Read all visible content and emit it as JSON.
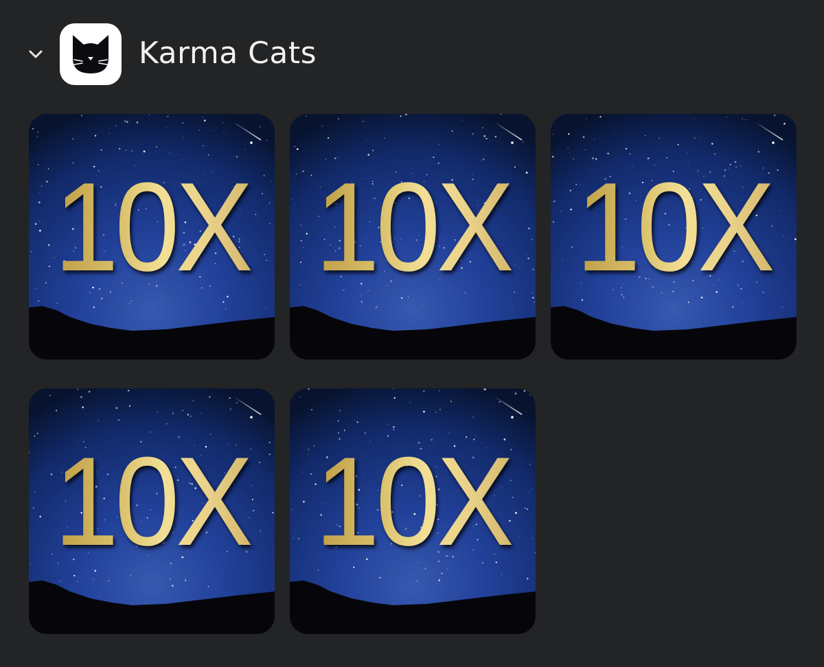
{
  "group": {
    "title": "Karma Cats",
    "icon": "black-cat-icon",
    "collapse_icon": "chevron-down-icon"
  },
  "tiles": [
    {
      "label": "10X"
    },
    {
      "label": "10X"
    },
    {
      "label": "10X"
    },
    {
      "label": "10X"
    },
    {
      "label": "10X"
    }
  ],
  "colors": {
    "background": "#222426",
    "sky_top": "#07132f",
    "sky_mid": "#17307a",
    "sky_glow": "#3859b0",
    "ground": "#06060a",
    "gold_light": "#f2df95",
    "gold_dark": "#b8963e",
    "title_text": "#f2f2f2"
  }
}
